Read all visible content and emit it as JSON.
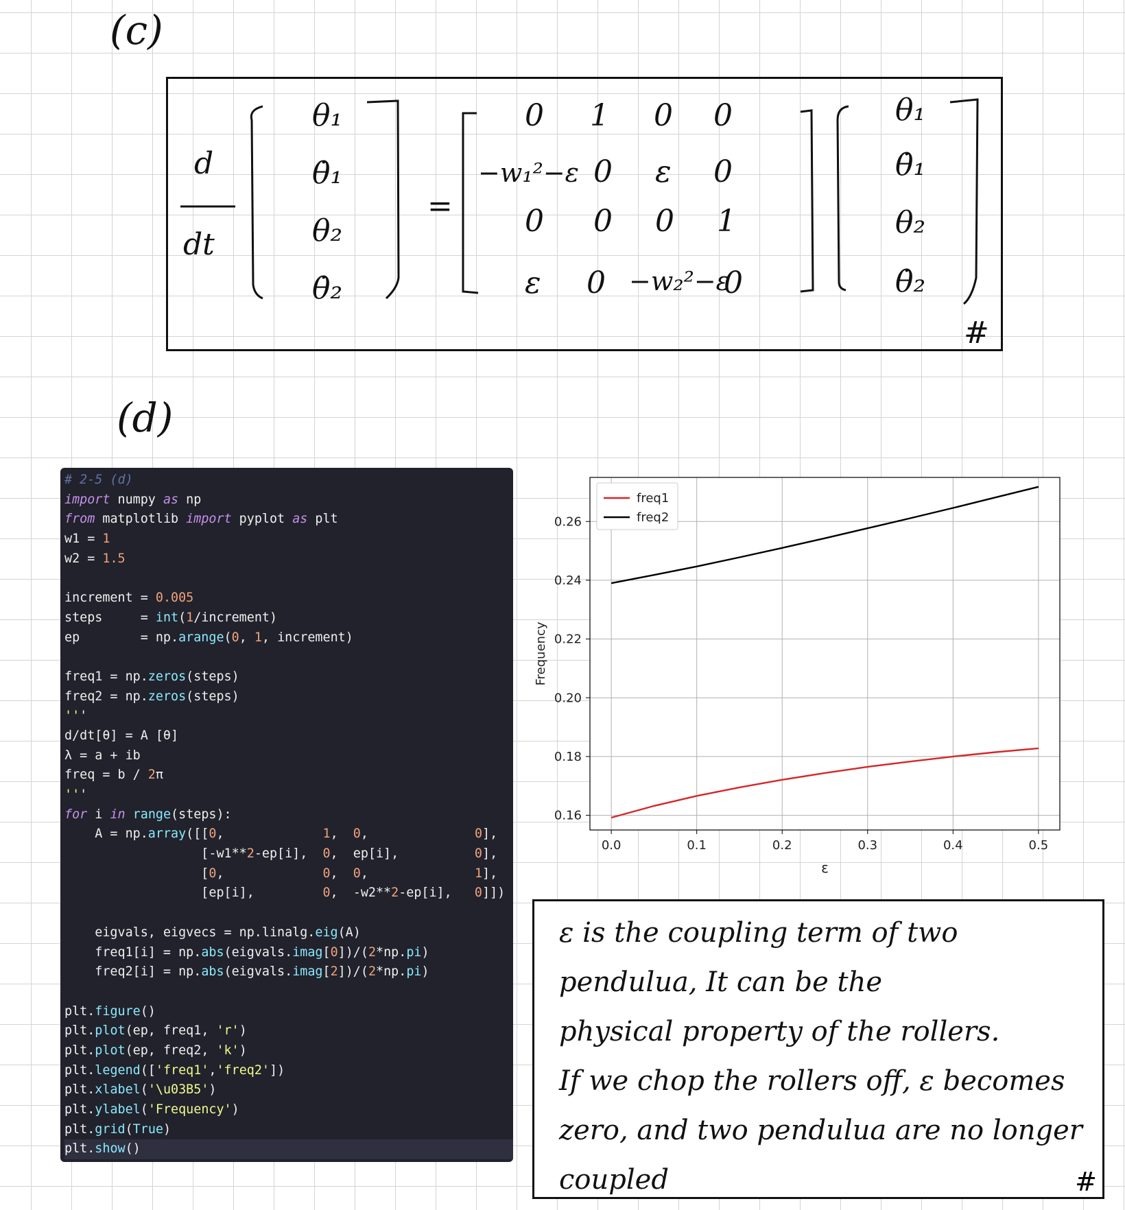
{
  "labels": {
    "part_c": "(c)",
    "part_d": "(d)"
  },
  "equation": {
    "lhs_numer": "d",
    "lhs_denom": "dt",
    "state_vector": [
      "θ₁",
      "θ̇₁",
      "θ₂",
      "θ̇₂"
    ],
    "equals": "=",
    "matrix": [
      [
        "0",
        "1",
        "0",
        "0"
      ],
      [
        "−w₁²−ε",
        "0",
        "ε",
        "0"
      ],
      [
        "0",
        "0",
        "0",
        "1"
      ],
      [
        "ε",
        "0",
        "−w₂²−ε",
        "0"
      ]
    ],
    "rhs_vector": [
      "θ₁",
      "θ̇₁",
      "θ₂",
      "θ̇₂"
    ],
    "end_mark": "#"
  },
  "code": {
    "lines": [
      "# 2-5 (d)",
      "import numpy as np",
      "from matplotlib import pyplot as plt",
      "w1 = 1",
      "w2 = 1.5",
      "",
      "increment = 0.005",
      "steps     = int(1/increment)",
      "ep        = np.arange(0, 1, increment)",
      "",
      "freq1 = np.zeros(steps)",
      "freq2 = np.zeros(steps)",
      "'''",
      "d/dt[θ] = A [θ]",
      "λ = a + ib",
      "freq = b / 2π",
      "'''",
      "for i in range(steps):",
      "    A = np.array([[0,             1,  0,              0],",
      "                  [-w1**2-ep[i],  0,  ep[i],          0],",
      "                  [0,             0,  0,              1],",
      "                  [ep[i],         0,  -w2**2-ep[i],   0]])",
      "",
      "    eigvals, eigvecs = np.linalg.eig(A)",
      "    freq1[i] = np.abs(eigvals.imag[0])/(2*np.pi)",
      "    freq2[i] = np.abs(eigvals.imag[2])/(2*np.pi)",
      "",
      "plt.figure()",
      "plt.plot(ep, freq1, 'r')",
      "plt.plot(ep, freq2, 'k')",
      "plt.legend(['freq1','freq2'])",
      "plt.xlabel('\\u03B5')",
      "plt.ylabel('Frequency')",
      "plt.grid(True)",
      "plt.show()"
    ]
  },
  "chart_data": {
    "type": "line",
    "title": "",
    "xlabel": "ε",
    "ylabel": "Frequency",
    "xlim": [
      -0.025,
      0.525
    ],
    "ylim": [
      0.155,
      0.275
    ],
    "xticks": [
      0.0,
      0.1,
      0.2,
      0.3,
      0.4,
      0.5
    ],
    "xtick_labels": [
      "0.0",
      "0.1",
      "0.2",
      "0.3",
      "0.4",
      "0.5"
    ],
    "yticks": [
      0.16,
      0.18,
      0.2,
      0.22,
      0.24,
      0.26
    ],
    "ytick_labels": [
      "0.16",
      "0.18",
      "0.20",
      "0.22",
      "0.24",
      "0.26"
    ],
    "grid": true,
    "legend_position": "upper-left",
    "x": [
      0.0,
      0.05,
      0.1,
      0.15,
      0.2,
      0.25,
      0.3,
      0.35,
      0.4,
      0.45,
      0.5
    ],
    "series": [
      {
        "name": "freq1",
        "color": "#d62728",
        "values": [
          0.1592,
          0.1632,
          0.1666,
          0.1695,
          0.1721,
          0.1744,
          0.1765,
          0.1783,
          0.18,
          0.1815,
          0.1828
        ]
      },
      {
        "name": "freq2",
        "color": "#000000",
        "values": [
          0.239,
          0.2418,
          0.2447,
          0.2478,
          0.251,
          0.2543,
          0.2577,
          0.2611,
          0.2646,
          0.2682,
          0.2718
        ]
      }
    ]
  },
  "answer": {
    "lines": [
      "ε is the coupling term of two",
      "pendulua, It can be the",
      "physical property of the rollers.",
      "If we chop the rollers off, ε becomes",
      "zero, and two pendulua are no longer",
      "coupled"
    ],
    "end_mark": "#"
  }
}
